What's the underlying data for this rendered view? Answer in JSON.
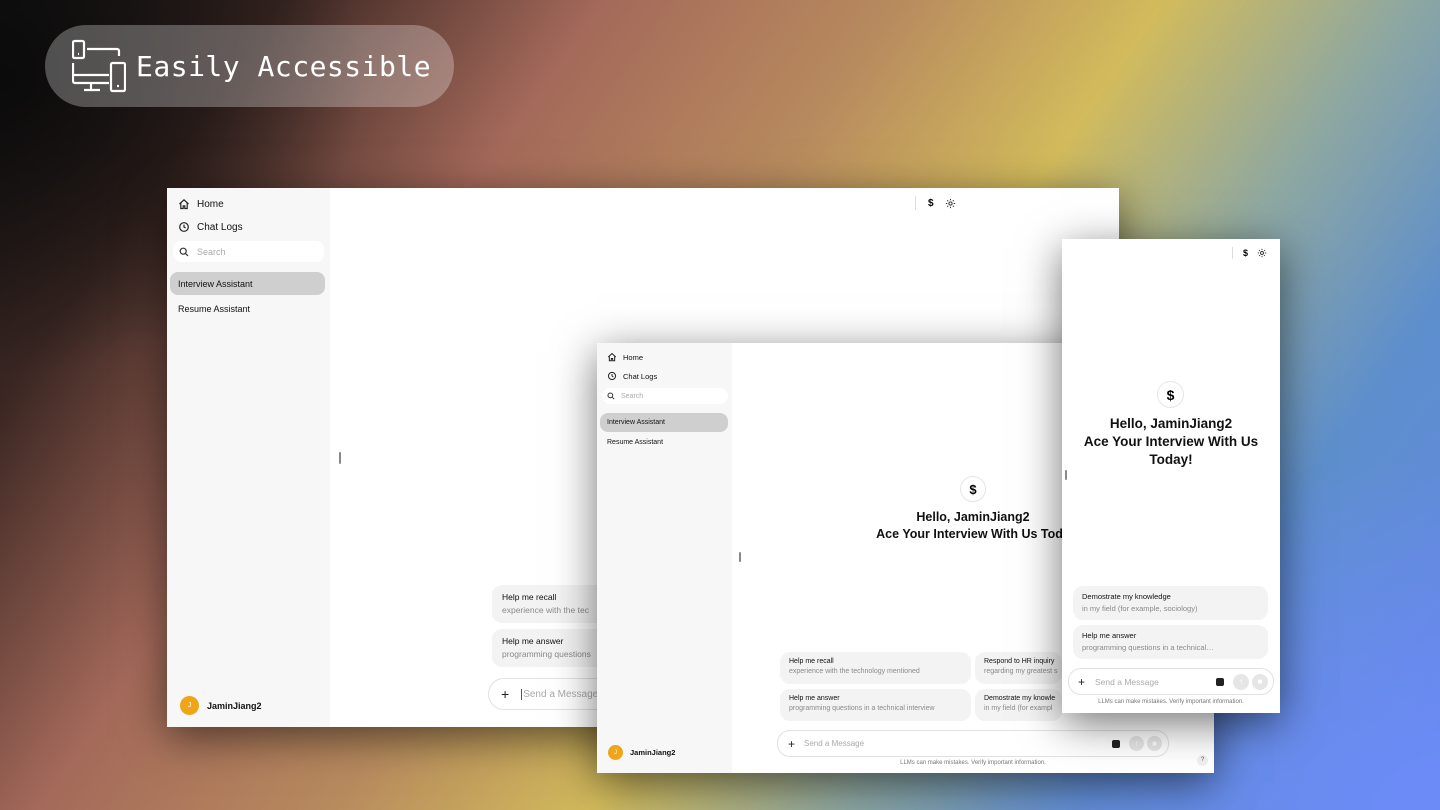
{
  "badge": {
    "label": "Easily Accessible",
    "icon": "devices-icon"
  },
  "app": {
    "nav": {
      "home": "Home",
      "chat_logs": "Chat Logs"
    },
    "search_placeholder": "Search",
    "conversations": [
      "Interview Assistant",
      "Resume Assistant"
    ],
    "user": {
      "initial": "J",
      "name": "JaminJiang2"
    },
    "greeting": {
      "line1": "Hello, JaminJiang2",
      "line2": "Ace Your Interview With Us Today!"
    },
    "greeting_clipped": {
      "line2": "Ace Your Interview With Us Toda"
    },
    "greeting_mobile": {
      "line1": "Hello, JaminJiang2",
      "line2": "Ace Your Interview With Us",
      "line3": "Today!"
    },
    "suggestions": [
      {
        "title": "Help me recall",
        "subtitle": "experience with the technology mentioned"
      },
      {
        "title": "Respond to HR inquiry",
        "subtitle": "regarding my greatest strength"
      },
      {
        "title": "Help me answer",
        "subtitle": "programming questions in a technical interview"
      },
      {
        "title": "Demostrate my knowledge",
        "subtitle": "in my field (for example, sociology)"
      }
    ],
    "suggestions_left_window": [
      {
        "title": "Help me recall",
        "subtitle": "experience with the tec"
      },
      {
        "title": "Help me answer",
        "subtitle": "programming questions"
      }
    ],
    "suggestions_mobile": [
      {
        "title": "Demostrate my knowledge",
        "subtitle": "in my field (for example, sociology)"
      },
      {
        "title": "Help me answer",
        "subtitle": "programming questions in a technical…"
      }
    ],
    "suggestions_mid_clipped": [
      {
        "title": "Respond to HR inquiry",
        "subtitle": "regarding my greatest s"
      },
      {
        "title": "Demostrate my knowle",
        "subtitle": "in my field (for exampl"
      }
    ],
    "message_placeholder": "Send a Message",
    "disclaimer": "LLMs can make mistakes. Verify important information.",
    "help": "?",
    "logo_glyph": "$",
    "accent_color": "#f0a417"
  }
}
